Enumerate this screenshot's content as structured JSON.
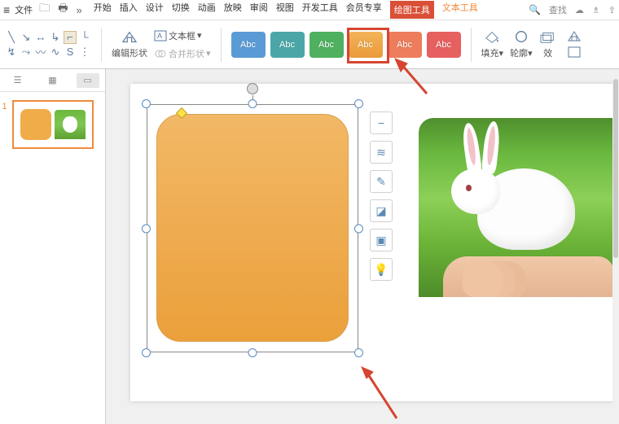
{
  "topbar": {
    "file_label": "文件",
    "tabs": [
      "开始",
      "插入",
      "设计",
      "切换",
      "动画",
      "放映",
      "审阅",
      "视图",
      "开发工具",
      "会员专享"
    ],
    "active_drawing": "绘图工具",
    "active_text": "文本工具",
    "search_label": "查找"
  },
  "ribbon": {
    "edit_shape_label": "编辑形状",
    "textbox_label": "文本框",
    "merge_label": "合并形状",
    "fill_label": "填充",
    "outline_label": "轮廓",
    "style_swatch_text": "Abc"
  },
  "thumbnail": {
    "slide_number": "1"
  }
}
